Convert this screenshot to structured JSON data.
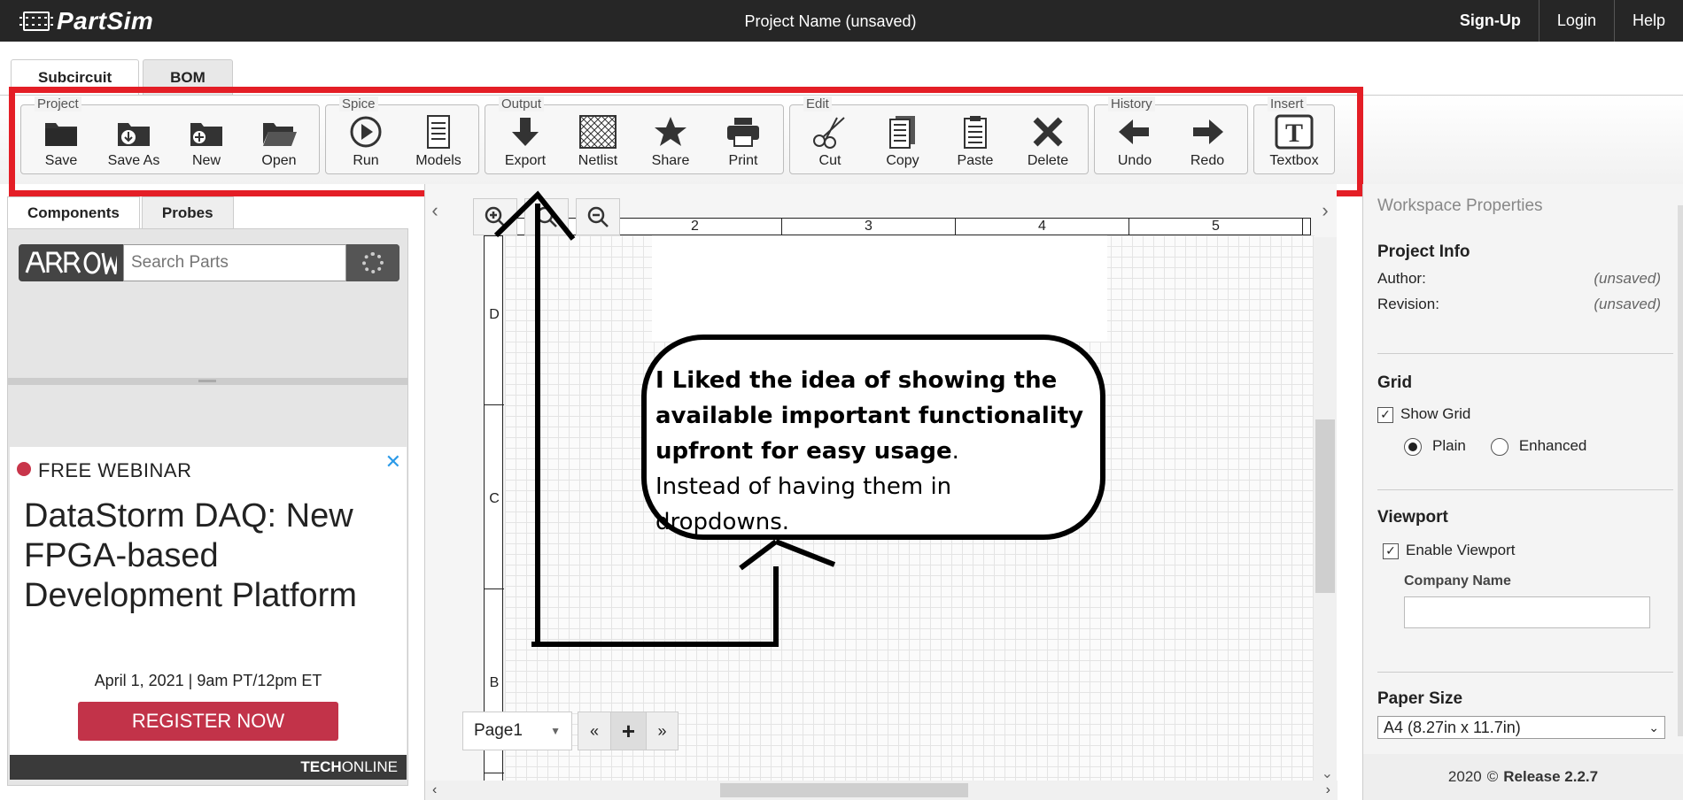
{
  "app": {
    "logo_text": "PartSim",
    "project_name": "Project Name (unsaved)"
  },
  "nav": [
    {
      "label": "Sign-Up"
    },
    {
      "label": "Login"
    },
    {
      "label": "Help"
    }
  ],
  "main_tabs": [
    {
      "label": "Subcircuit",
      "active": true
    },
    {
      "label": "BOM",
      "active": false
    }
  ],
  "toolbar": {
    "highlight_color": "#e41e26",
    "groups": [
      {
        "label": "Project",
        "tools": [
          {
            "label": "Save",
            "icon": "folder-save-icon"
          },
          {
            "label": "Save As",
            "icon": "folder-download-icon"
          },
          {
            "label": "New",
            "icon": "folder-add-icon"
          },
          {
            "label": "Open",
            "icon": "folder-open-icon"
          }
        ]
      },
      {
        "label": "Spice",
        "tools": [
          {
            "label": "Run",
            "icon": "play-icon"
          },
          {
            "label": "Models",
            "icon": "document-icon"
          }
        ]
      },
      {
        "label": "Output",
        "tools": [
          {
            "label": "Export",
            "icon": "download-arrow-icon"
          },
          {
            "label": "Netlist",
            "icon": "netlist-icon"
          },
          {
            "label": "Share",
            "icon": "star-icon"
          },
          {
            "label": "Print",
            "icon": "printer-icon"
          }
        ]
      },
      {
        "label": "Edit",
        "tools": [
          {
            "label": "Cut",
            "icon": "scissors-icon"
          },
          {
            "label": "Copy",
            "icon": "copy-icon"
          },
          {
            "label": "Paste",
            "icon": "clipboard-icon"
          },
          {
            "label": "Delete",
            "icon": "x-icon"
          }
        ]
      },
      {
        "label": "History",
        "tools": [
          {
            "label": "Undo",
            "icon": "arrow-left-icon"
          },
          {
            "label": "Redo",
            "icon": "arrow-right-icon"
          }
        ]
      },
      {
        "label": "Insert",
        "tools": [
          {
            "label": "Textbox",
            "icon": "textbox-icon"
          }
        ]
      }
    ]
  },
  "left_panel": {
    "tabs": [
      {
        "label": "Components",
        "active": true
      },
      {
        "label": "Probes",
        "active": false
      }
    ],
    "search": {
      "brand": "ARROW",
      "placeholder": "Search Parts"
    },
    "ad": {
      "kicker": "FREE WEBINAR",
      "headline": "DataStorm DAQ: New FPGA-based Development Platform",
      "date": "April 1, 2021 | 9am PT/12pm ET",
      "cta": "REGISTER NOW",
      "sponsor_bold": "TECH",
      "sponsor_rest": "ONLINE",
      "close": "✕"
    }
  },
  "canvas": {
    "ruler_top": [
      "",
      "2",
      "3",
      "4",
      "5"
    ],
    "ruler_left": [
      "D",
      "C",
      "B"
    ],
    "page": {
      "label": "Page1",
      "prev": "«",
      "add": "+",
      "next": "»"
    },
    "nav_left": "‹",
    "nav_right": "›"
  },
  "annotation": {
    "bold_line": "I Liked the idea of showing the available important functionality upfront for easy usage",
    "period": ".",
    "normal_line": "Instead of having them in dropdowns."
  },
  "right_panel": {
    "title": "Workspace Properties",
    "project_info": {
      "heading": "Project Info",
      "author_label": "Author:",
      "author_value": "(unsaved)",
      "revision_label": "Revision:",
      "revision_value": "(unsaved)"
    },
    "grid": {
      "heading": "Grid",
      "show_grid_label": "Show Grid",
      "show_grid_checked": true,
      "plain_label": "Plain",
      "enhanced_label": "Enhanced",
      "selected": "Plain"
    },
    "viewport": {
      "heading": "Viewport",
      "enable_label": "Enable Viewport",
      "enable_checked": true,
      "company_label": "Company Name",
      "company_value": ""
    },
    "paper": {
      "heading": "Paper Size",
      "selected": "A4 (8.27in x 11.7in)"
    },
    "footer": {
      "year": "2020",
      "release": "Release 2.2.7"
    }
  }
}
